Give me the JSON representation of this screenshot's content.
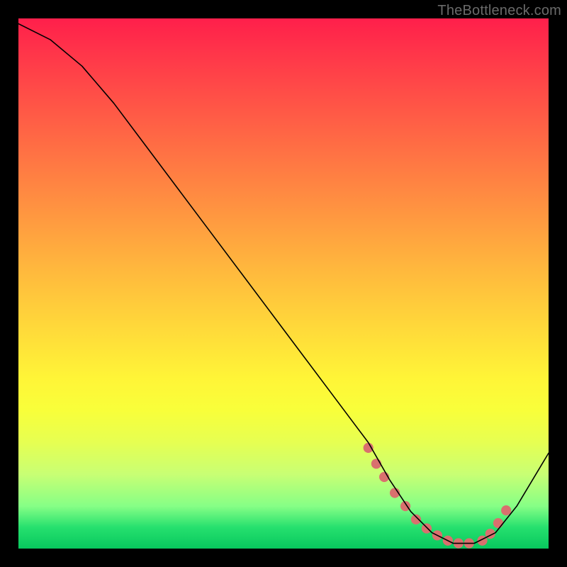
{
  "watermark": "TheBottleneck.com",
  "chart_data": {
    "type": "line",
    "title": "",
    "xlabel": "",
    "ylabel": "",
    "xlim": [
      0,
      100
    ],
    "ylim": [
      0,
      100
    ],
    "grid": false,
    "background": "red-to-green vertical gradient",
    "series": [
      {
        "name": "curve",
        "color": "#000000",
        "x": [
          0,
          6,
          12,
          18,
          24,
          30,
          36,
          42,
          48,
          54,
          60,
          66,
          70,
          74,
          78,
          82,
          86,
          90,
          94,
          100
        ],
        "values": [
          99,
          96,
          91,
          84,
          76,
          68,
          60,
          52,
          44,
          36,
          28,
          20,
          13,
          7,
          3,
          1,
          1,
          3,
          8,
          18
        ]
      },
      {
        "name": "highlight-dots",
        "color": "#d9706e",
        "x": [
          66.0,
          67.5,
          69.0,
          71.0,
          73.0,
          75.0,
          77.0,
          79.0,
          81.0,
          83.0,
          85.0,
          87.5,
          89.0,
          90.5,
          92.0
        ],
        "values": [
          19.0,
          16.0,
          13.5,
          10.5,
          8.0,
          5.5,
          3.8,
          2.5,
          1.5,
          1.0,
          1.0,
          1.5,
          2.8,
          4.8,
          7.2
        ]
      }
    ]
  },
  "colors": {
    "curve": "#000000",
    "dots": "#d9706e",
    "page_bg": "#000000",
    "watermark": "#6a6a6a"
  }
}
